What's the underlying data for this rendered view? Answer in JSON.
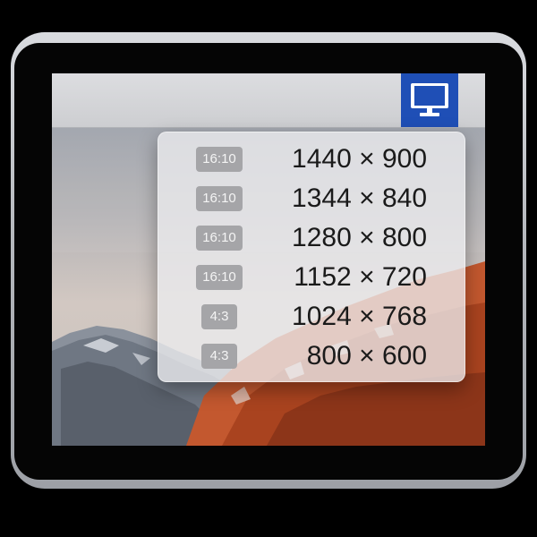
{
  "menubar": {
    "icon": "display-icon",
    "accent_color": "#1f4fb6"
  },
  "resolutions": [
    {
      "ratio": "16:10",
      "label": "1440 × 900"
    },
    {
      "ratio": "16:10",
      "label": "1344 × 840"
    },
    {
      "ratio": "16:10",
      "label": "1280 × 800"
    },
    {
      "ratio": "16:10",
      "label": "1152 × 720"
    },
    {
      "ratio": "4:3",
      "label": "1024 × 768"
    },
    {
      "ratio": "4:3",
      "label": "800 × 600"
    }
  ]
}
